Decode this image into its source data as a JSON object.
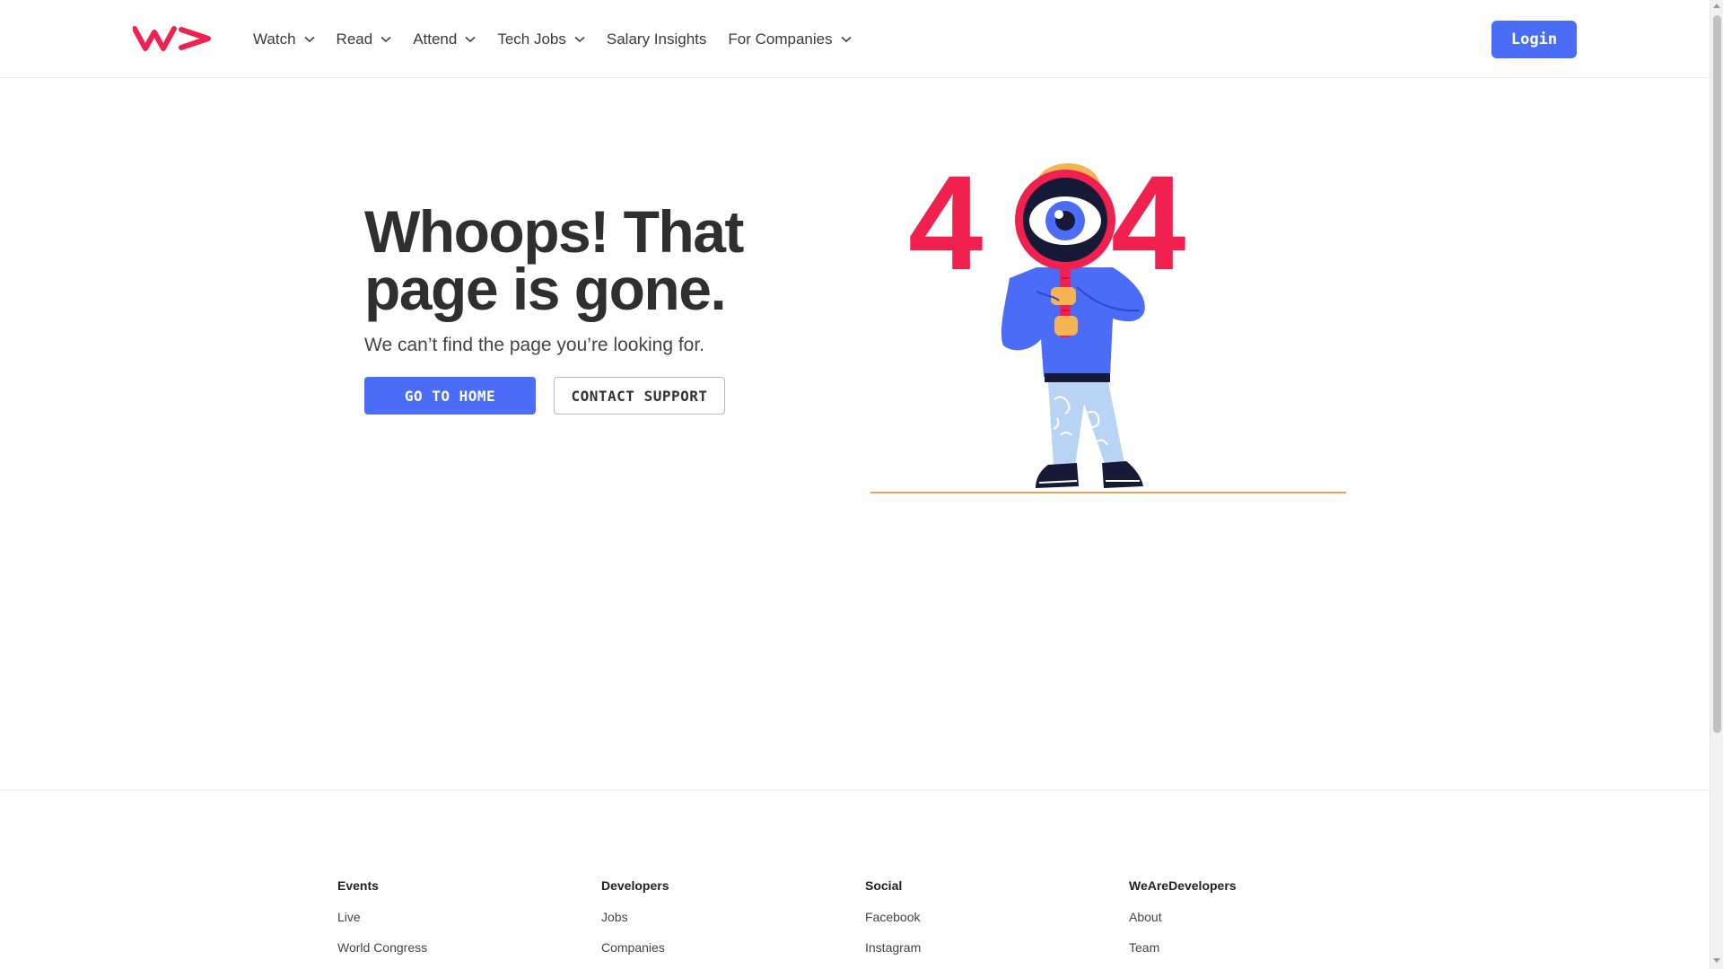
{
  "colors": {
    "brand_red": "#f0204f",
    "primary_blue": "#4a6cf7",
    "text_dark": "#2f2f2f",
    "ground_orange": "#f2a15a"
  },
  "header": {
    "logo_icon": "wearedevelopers-logo-icon",
    "nav": [
      {
        "label": "Watch",
        "has_dropdown": true
      },
      {
        "label": "Read",
        "has_dropdown": true
      },
      {
        "label": "Attend",
        "has_dropdown": true
      },
      {
        "label": "Tech Jobs",
        "has_dropdown": true
      },
      {
        "label": "Salary Insights",
        "has_dropdown": false
      },
      {
        "label": "For Companies",
        "has_dropdown": true
      }
    ],
    "login_label": "Login"
  },
  "hero": {
    "title_line1": "Whoops! That",
    "title_line2": "page is gone.",
    "subtitle": "We can’t find the page you’re looking for.",
    "home_button": "GO TO HOME",
    "support_button": "CONTACT SUPPORT",
    "illustration": {
      "icon": "404-magnifier-person-illustration",
      "digit_left": "4",
      "digit_right": "4"
    }
  },
  "footer": {
    "columns": [
      {
        "heading": "Events",
        "links": [
          "Live",
          "World Congress"
        ]
      },
      {
        "heading": "Developers",
        "links": [
          "Jobs",
          "Companies"
        ]
      },
      {
        "heading": "Social",
        "links": [
          "Facebook",
          "Instagram"
        ]
      },
      {
        "heading": "WeAreDevelopers",
        "links": [
          "About",
          "Team"
        ]
      }
    ]
  }
}
